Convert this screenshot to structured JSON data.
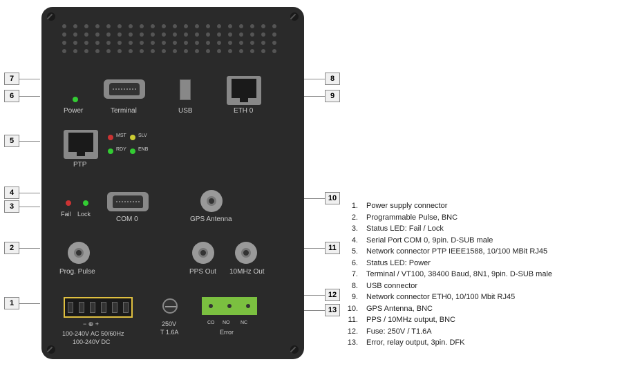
{
  "panel": {
    "power_label": "Power",
    "terminal_label": "Terminal",
    "usb_label": "USB",
    "eth0_label": "ETH 0",
    "ptp_label": "PTP",
    "fail_label": "Fail",
    "lock_label": "Lock",
    "com0_label": "COM 0",
    "gps_label": "GPS Antenna",
    "prog_label": "Prog. Pulse",
    "pps_label": "PPS Out",
    "mhz_label": "10MHz Out",
    "mst": "MST",
    "slv": "SLV",
    "rdy": "RDY",
    "enb": "ENB",
    "power_spec1": "100-240V AC 50/60Hz",
    "power_spec2": "100-240V DC",
    "power_sym": "−  ⊕  +",
    "fuse_v": "250V",
    "fuse_a": "T 1.6A",
    "relay_co": "CO",
    "relay_no": "NO",
    "relay_nc": "NC",
    "error_label": "Error"
  },
  "callouts": {
    "n1": "1",
    "n2": "2",
    "n3": "3",
    "n4": "4",
    "n5": "5",
    "n6": "6",
    "n7": "7",
    "n8": "8",
    "n9": "9",
    "n10": "10",
    "n11": "11",
    "n12": "12",
    "n13": "13"
  },
  "legend": [
    {
      "n": "1.",
      "t": "Power supply connector"
    },
    {
      "n": "2.",
      "t": "Programmable Pulse, BNC"
    },
    {
      "n": "3.",
      "t": "Status LED: Fail / Lock"
    },
    {
      "n": "4.",
      "t": "Serial Port COM 0,  9pin. D-SUB male"
    },
    {
      "n": "5.",
      "t": "Network connector PTP IEEE1588, 10/100 MBit RJ45"
    },
    {
      "n": "6.",
      "t": "Status LED: Power"
    },
    {
      "n": "7.",
      "t": "Terminal / VT100, 38400 Baud, 8N1, 9pin. D-SUB male"
    },
    {
      "n": "8.",
      "t": "USB connector"
    },
    {
      "n": "9.",
      "t": "Network connector ETH0, 10/100 Mbit RJ45"
    },
    {
      "n": "10.",
      "t": "GPS Antenna, BNC"
    },
    {
      "n": "11.",
      "t": "PPS / 10MHz output, BNC"
    },
    {
      "n": "12.",
      "t": "Fuse: 250V / T1.6A"
    },
    {
      "n": "13.",
      "t": "Error, relay output, 3pin. DFK"
    }
  ]
}
